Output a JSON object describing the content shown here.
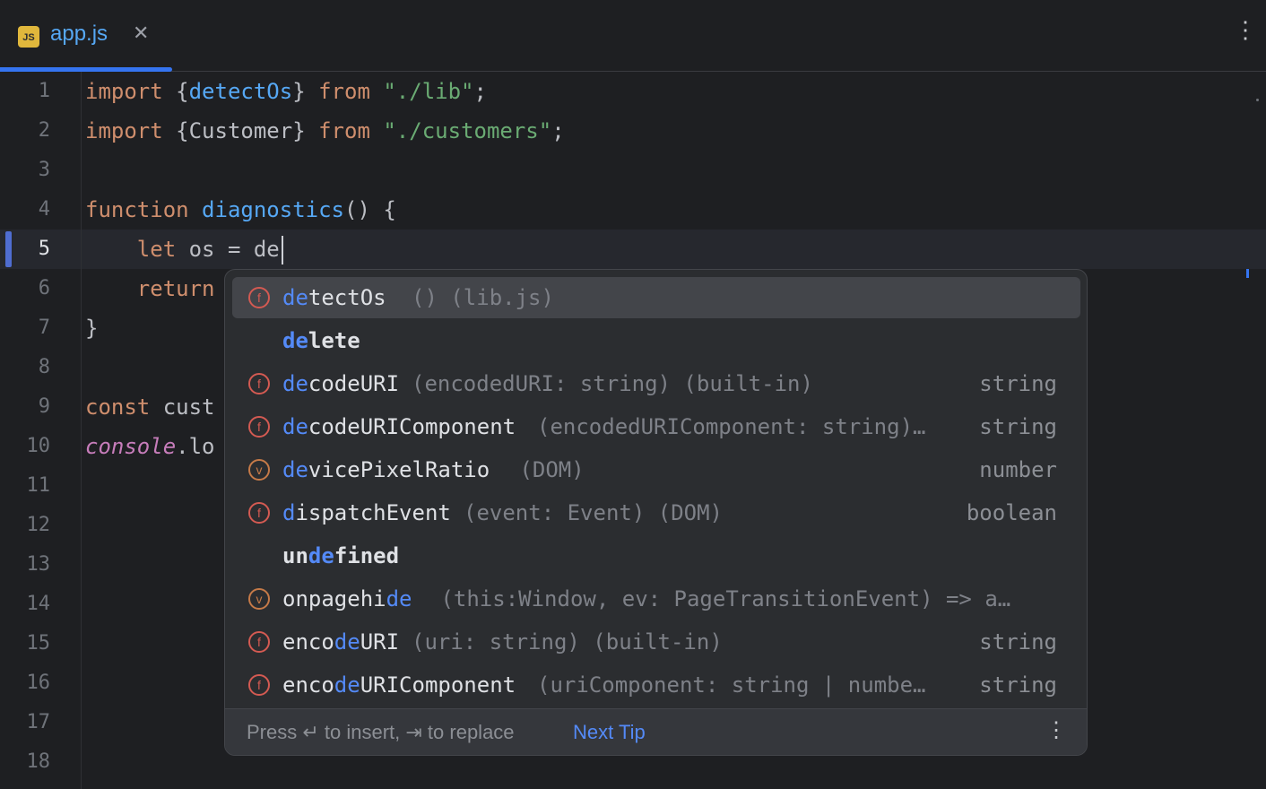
{
  "tab": {
    "badge": "JS",
    "title": "app.js",
    "close": "✕",
    "menu": "⋮"
  },
  "gutter": {
    "line_numbers": [
      "1",
      "2",
      "3",
      "4",
      "5",
      "6",
      "7",
      "8",
      "9",
      "10",
      "11",
      "12",
      "13",
      "14",
      "15",
      "16",
      "17",
      "18"
    ]
  },
  "code": {
    "l1": {
      "a": "import ",
      "b": "{",
      "c": "detectOs",
      "d": "} ",
      "e": "from ",
      "f": "\"./lib\"",
      "g": ";"
    },
    "l2": {
      "a": "import ",
      "b": "{Customer} ",
      "e": "from ",
      "f": "\"./customers\"",
      "g": ";"
    },
    "l4": {
      "a": "function ",
      "b": "diagnostics",
      "c": "() {"
    },
    "l5": {
      "a": "    let ",
      "b": "os = de"
    },
    "l6": {
      "a": "    return"
    },
    "l7": {
      "a": "}"
    },
    "l9": {
      "a": "const ",
      "b": "cust"
    },
    "l10": {
      "a": "console",
      "b": ".lo"
    }
  },
  "completion": {
    "items": [
      {
        "kind": "f",
        "pre": "",
        "match": "de",
        "post": "tectOs",
        "desc": "() (lib.js)",
        "type": ""
      },
      {
        "kind": "",
        "pre": "",
        "match": "de",
        "post": "lete",
        "desc": "",
        "type": ""
      },
      {
        "kind": "f",
        "pre": "",
        "match": "de",
        "post": "codeURI",
        "desc": "(encodedURI: string) (built-in)",
        "type": "string"
      },
      {
        "kind": "f",
        "pre": "",
        "match": "de",
        "post": "codeURIComponent",
        "desc": "(encodedURIComponent: string)…",
        "type": "string"
      },
      {
        "kind": "v",
        "pre": "",
        "match": "de",
        "post": "vicePixelRatio",
        "desc": " (DOM)",
        "type": "number"
      },
      {
        "kind": "f",
        "pre": "",
        "match": "d",
        "post": "ispatchEvent",
        "desc": "(event: Event) (DOM)",
        "type": "boolean"
      },
      {
        "kind": "",
        "pre": "un",
        "match": "de",
        "post": "fined",
        "desc": "",
        "type": ""
      },
      {
        "kind": "v",
        "pre": "onpagehi",
        "match": "de",
        "post": "",
        "desc": " (this:Window, ev: PageTransitionEvent) => a…",
        "type": ""
      },
      {
        "kind": "f",
        "pre": "enco",
        "match": "de",
        "post": "URI",
        "desc": "(uri: string) (built-in)",
        "type": "string"
      },
      {
        "kind": "f",
        "pre": "enco",
        "match": "de",
        "post": "URIComponent",
        "desc": "(uriComponent: string | numbe…",
        "type": "string"
      }
    ],
    "footer": {
      "hint": "Press ↵ to insert, ⇥ to replace",
      "next_tip": "Next Tip",
      "menu": "⋮"
    }
  },
  "colors": {
    "accent": "#3574f0",
    "match": "#548af7",
    "keyword": "#cf8e6d",
    "string": "#6aab73",
    "function": "#56a8f5"
  }
}
